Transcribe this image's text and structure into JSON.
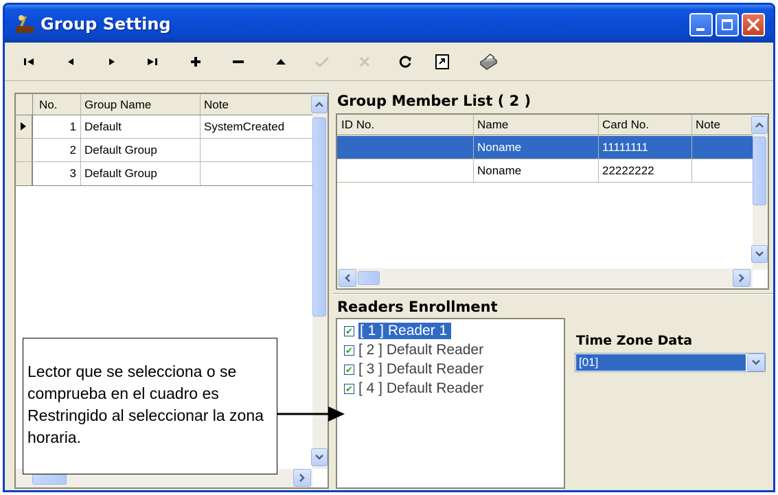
{
  "window": {
    "title": "Group Setting"
  },
  "groups": {
    "columns": [
      "No.",
      "Group Name",
      "Note"
    ],
    "rows": [
      {
        "no": "1",
        "name": "Default",
        "note": "SystemCreated"
      },
      {
        "no": "2",
        "name": "Default Group",
        "note": ""
      },
      {
        "no": "3",
        "name": "Default Group",
        "note": ""
      }
    ]
  },
  "members": {
    "title": "Group Member List ( 2 )",
    "columns": [
      "ID No.",
      "Name",
      "Card No.",
      "Note"
    ],
    "rows": [
      {
        "id": "",
        "name": "Noname",
        "card": "11111111",
        "note": ""
      },
      {
        "id": "",
        "name": "Noname",
        "card": "22222222",
        "note": ""
      }
    ]
  },
  "readers": {
    "title": "Readers Enrollment",
    "items": [
      {
        "label": "[ 1 ] Reader 1",
        "checked": true
      },
      {
        "label": "[ 2 ] Default Reader",
        "checked": true
      },
      {
        "label": "[ 3 ] Default Reader",
        "checked": true
      },
      {
        "label": "[ 4 ] Default Reader",
        "checked": true
      }
    ]
  },
  "time_zone": {
    "label": "Time Zone Data",
    "value": "[01]"
  },
  "annotation": {
    "text": "Lector que se selecciona o se comprueba en el cuadro es Restringido al seleccionar la zona horaria."
  },
  "colors": {
    "titlebar": "#0a4bd6",
    "selection": "#316ac5",
    "window_bg": "#ece9d8"
  }
}
